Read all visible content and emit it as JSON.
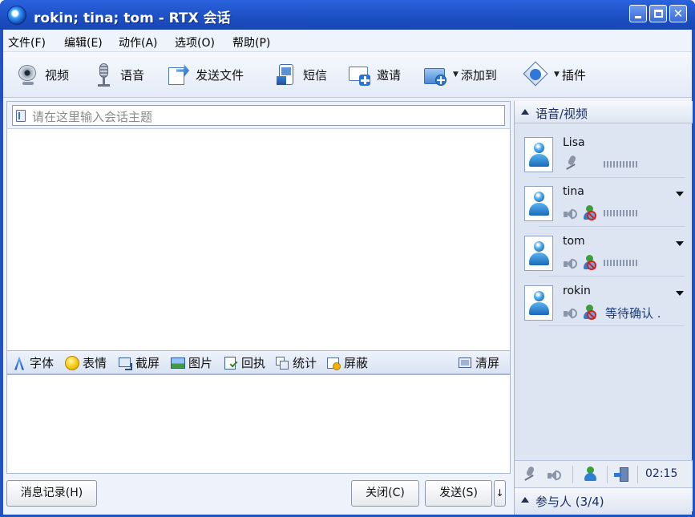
{
  "window": {
    "title": "rokin; tina; tom - RTX 会话"
  },
  "menu": {
    "items": [
      "文件(F)",
      "编辑(E)",
      "动作(A)",
      "选项(O)",
      "帮助(P)"
    ]
  },
  "toolbar": {
    "video": "视频",
    "voice": "语音",
    "send_file": "发送文件",
    "sms": "短信",
    "invite": "邀请",
    "add_to": "添加到",
    "plugins": "插件"
  },
  "chat": {
    "subject_placeholder": "请在这里输入会话主题"
  },
  "format_bar": {
    "font": "字体",
    "emoticon": "表情",
    "screenshot": "截屏",
    "picture": "图片",
    "receipt": "回执",
    "stats": "统计",
    "block": "屏蔽",
    "clear": "清屏"
  },
  "buttons": {
    "history": "消息记录(H)",
    "close": "关闭(C)",
    "send": "发送(S)"
  },
  "voice_panel": {
    "title": "语音/视频",
    "participants": [
      {
        "name": "Lisa",
        "status": ""
      },
      {
        "name": "tina",
        "status": ""
      },
      {
        "name": "tom",
        "status": ""
      },
      {
        "name": "rokin",
        "status": "等待确认 ."
      }
    ],
    "timer": "02:15",
    "members_label": "参与人 (3/4)"
  },
  "colors": {
    "titlebar": "#1f53c5",
    "panel": "#dde5f3",
    "status_text": "#1b3d80"
  }
}
